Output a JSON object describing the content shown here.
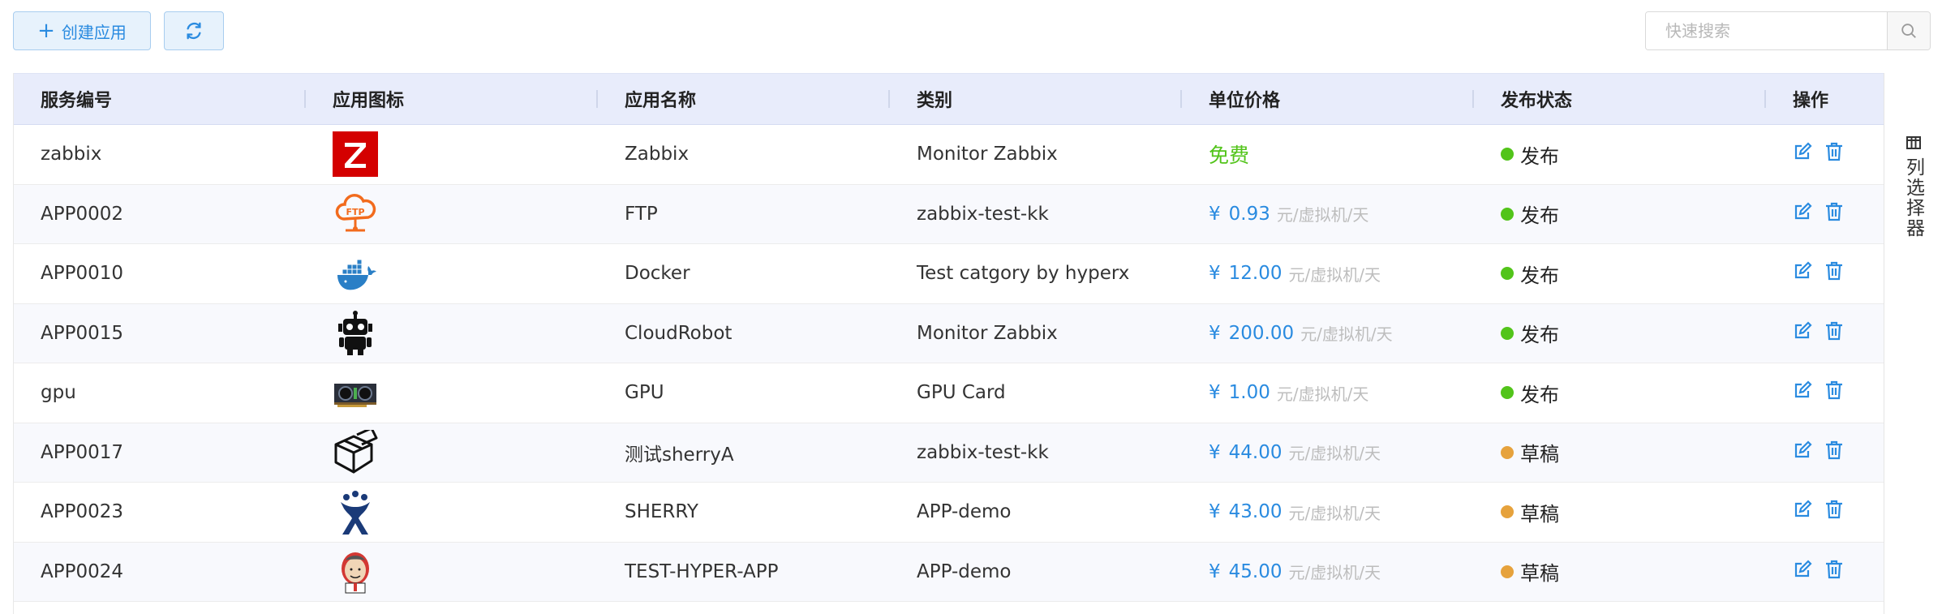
{
  "toolbar": {
    "create_label": "创建应用",
    "search_placeholder": "快速搜索"
  },
  "columns": [
    "服务编号",
    "应用图标",
    "应用名称",
    "类别",
    "单位价格",
    "发布状态",
    "操作"
  ],
  "rows": [
    {
      "id": "zabbix",
      "icon": "zabbix-icon",
      "name": "Zabbix",
      "category": "Monitor Zabbix",
      "price": "免费",
      "free": true,
      "status": "发布"
    },
    {
      "id": "APP0002",
      "icon": "ftp-cloud-icon",
      "name": "FTP",
      "category": "zabbix-test-kk",
      "price": "0.93",
      "free": false,
      "status": "发布"
    },
    {
      "id": "APP0010",
      "icon": "docker-icon",
      "name": "Docker",
      "category": "Test catgory by hyperx",
      "price": "12.00",
      "free": false,
      "status": "发布"
    },
    {
      "id": "APP0015",
      "icon": "robot-icon",
      "name": "CloudRobot",
      "category": "Monitor Zabbix",
      "price": "200.00",
      "free": false,
      "status": "发布"
    },
    {
      "id": "gpu",
      "icon": "gpu-card-icon",
      "name": "GPU",
      "category": "GPU Card",
      "price": "1.00",
      "free": false,
      "status": "发布"
    },
    {
      "id": "APP0017",
      "icon": "package-icon",
      "name": "测试sherryA",
      "category": "zabbix-test-kk",
      "price": "44.00",
      "free": false,
      "status": "草稿"
    },
    {
      "id": "APP0023",
      "icon": "jira-icon",
      "name": "SHERRY",
      "category": "APP-demo",
      "price": "43.00",
      "free": false,
      "status": "草稿"
    },
    {
      "id": "APP0024",
      "icon": "jenkins-icon",
      "name": "TEST-HYPER-APP",
      "category": "APP-demo",
      "price": "45.00",
      "free": false,
      "status": "草稿"
    }
  ],
  "currency_symbol": "¥",
  "price_unit": "元/虚拟机/天",
  "status_colors": {
    "发布": "#52c41a",
    "草稿": "#e6a23c"
  },
  "column_picker_label": "列选择器"
}
